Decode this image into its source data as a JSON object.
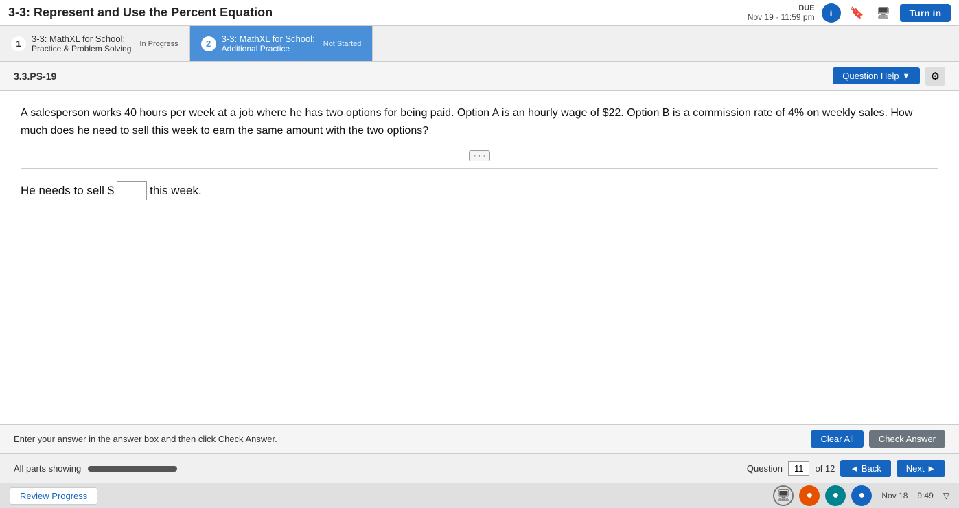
{
  "header": {
    "title": "3-3: Represent and Use the Percent Equation",
    "due_label": "DUE",
    "due_date": "Nov 19 · 11:59 pm",
    "turn_in_label": "Turn in"
  },
  "tabs": [
    {
      "number": "1",
      "title_line1": "3-3: MathXL for School:",
      "title_line2": "Practice & Problem Solving",
      "status": "In Progress",
      "active": false
    },
    {
      "number": "2",
      "title_line1": "3-3: MathXL for School:",
      "title_line2": "Additional Practice",
      "status": "Not Started",
      "active": true
    }
  ],
  "question": {
    "id": "3.3.PS-19",
    "help_label": "Question Help",
    "problem_text": "A salesperson works 40 hours per week at a job where he has two options for being paid. Option A is an hourly wage of $22. Option B is a commission rate of 4% on weekly sales. How much does he need to sell this week to earn the same amount with the two options?",
    "answer_prefix": "He needs to sell $",
    "answer_suffix": " this week.",
    "answer_placeholder": ""
  },
  "bottom_bar": {
    "instruction": "Enter your answer in the answer box and then click Check Answer.",
    "clear_all_label": "Clear All",
    "check_answer_label": "Check Answer"
  },
  "footer": {
    "parts_showing": "All parts showing",
    "question_label": "Question",
    "question_num": "11",
    "of_label": "of 12",
    "back_label": "◄ Back",
    "next_label": "Next ►"
  },
  "status_bar": {
    "review_progress_label": "Review Progress",
    "date": "Nov 18",
    "time": "9:49"
  }
}
